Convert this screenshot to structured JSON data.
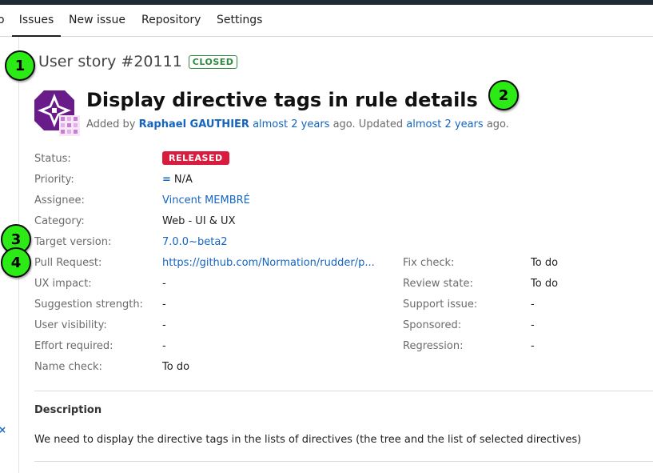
{
  "tabs": {
    "prev_fragment": "o",
    "items": [
      "Issues",
      "New issue",
      "Repository",
      "Settings"
    ]
  },
  "issue": {
    "type_and_id": "User story #20111",
    "state_badge": "CLOSED",
    "title": "Display directive tags in rule details",
    "byline": {
      "added_by_prefix": "Added by",
      "author": "Raphael GAUTHIER",
      "added_ago": "almost 2 years",
      "middle": "ago. Updated",
      "updated_ago": "almost 2 years",
      "suffix": "ago."
    }
  },
  "attributes_left": [
    {
      "label": "Status:",
      "value": "RELEASED"
    },
    {
      "label": "Priority:",
      "value": "N/A"
    },
    {
      "label": "Assignee:",
      "value": "Vincent MEMBRÉ"
    },
    {
      "label": "Category:",
      "value": "Web - UI & UX"
    },
    {
      "label": "Target version:",
      "value": "7.0.0~beta2"
    },
    {
      "label": "Pull Request:",
      "value": "https://github.com/Normation/rudder/p..."
    },
    {
      "label": "UX impact:",
      "value": "-"
    },
    {
      "label": "Suggestion strength:",
      "value": "-"
    },
    {
      "label": "User visibility:",
      "value": "-"
    },
    {
      "label": "Effort required:",
      "value": "-"
    },
    {
      "label": "Name check:",
      "value": "To do"
    }
  ],
  "attributes_right": [
    {
      "label": "Fix check:",
      "value": "To do"
    },
    {
      "label": "Review state:",
      "value": "To do"
    },
    {
      "label": "Support issue:",
      "value": "-"
    },
    {
      "label": "Sponsored:",
      "value": "-"
    },
    {
      "label": "Regression:",
      "value": "-"
    }
  ],
  "priority_icon": "=",
  "description": {
    "heading": "Description",
    "text": "We need to display the directive tags in the lists of directives (the tree and the list of selected directives)"
  },
  "sidebar": {
    "close_glyph": "×"
  },
  "markers": [
    "1",
    "2",
    "3",
    "4"
  ],
  "colors": {
    "link": "#1565c0",
    "closed_badge": "#2e8b3c",
    "released_badge": "#d91b3d",
    "marker": "#2bea15",
    "avatar_purple": "#6a1b8a"
  }
}
